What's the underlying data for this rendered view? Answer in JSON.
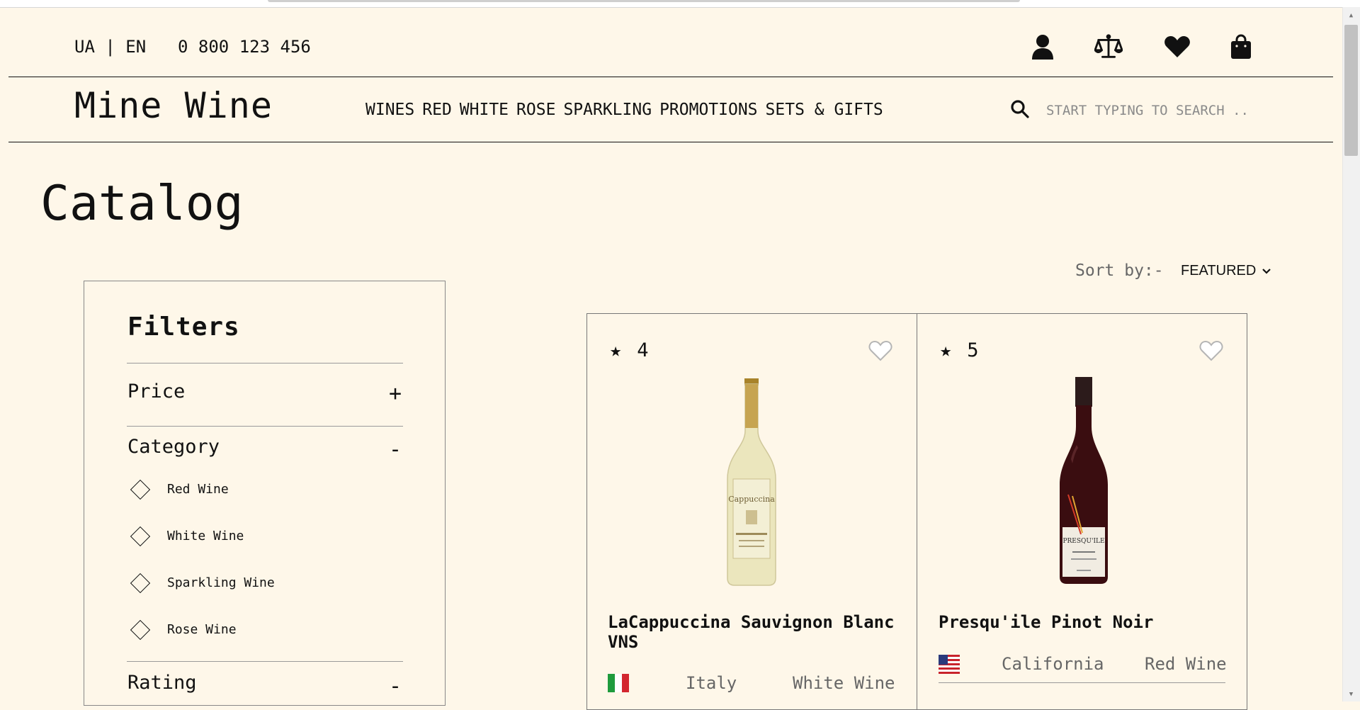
{
  "header": {
    "lang": "UA | EN",
    "phone": "0 800 123 456",
    "icons": [
      "user-icon",
      "scales-icon",
      "heart-icon",
      "bag-icon"
    ]
  },
  "brand": "Mine Wine",
  "nav": [
    "WINES",
    "RED",
    "WHITE",
    "ROSE",
    "SPARKLING",
    "PROMOTIONS",
    "SETS & GIFTS"
  ],
  "search": {
    "placeholder": "START TYPING TO SEARCH .."
  },
  "catalog": {
    "title": "Catalog",
    "sort_label": "Sort by:-",
    "sort_value": "FEATURED"
  },
  "filters": {
    "title": "Filters",
    "price": {
      "label": "Price",
      "toggle": "+"
    },
    "category": {
      "label": "Category",
      "toggle": "-",
      "items": [
        "Red Wine",
        "White Wine",
        "Sparkling Wine",
        "Rose Wine"
      ]
    },
    "rating": {
      "label": "Rating",
      "toggle": "-"
    }
  },
  "products": [
    {
      "rating": "4",
      "name": "LaCappuccina Sauvignon Blanc VNS",
      "origin": "Italy",
      "type": "White Wine",
      "flag": "italy-flag",
      "bottle_color": "#e8e2b8"
    },
    {
      "rating": "5",
      "name": "Presqu'ile Pinot Noir",
      "origin": "California",
      "type": "Red Wine",
      "flag": "usa-flag",
      "bottle_color": "#3a0d10"
    }
  ],
  "colors": {
    "background": "#fef7e9",
    "text": "#111111",
    "muted": "#666666"
  }
}
